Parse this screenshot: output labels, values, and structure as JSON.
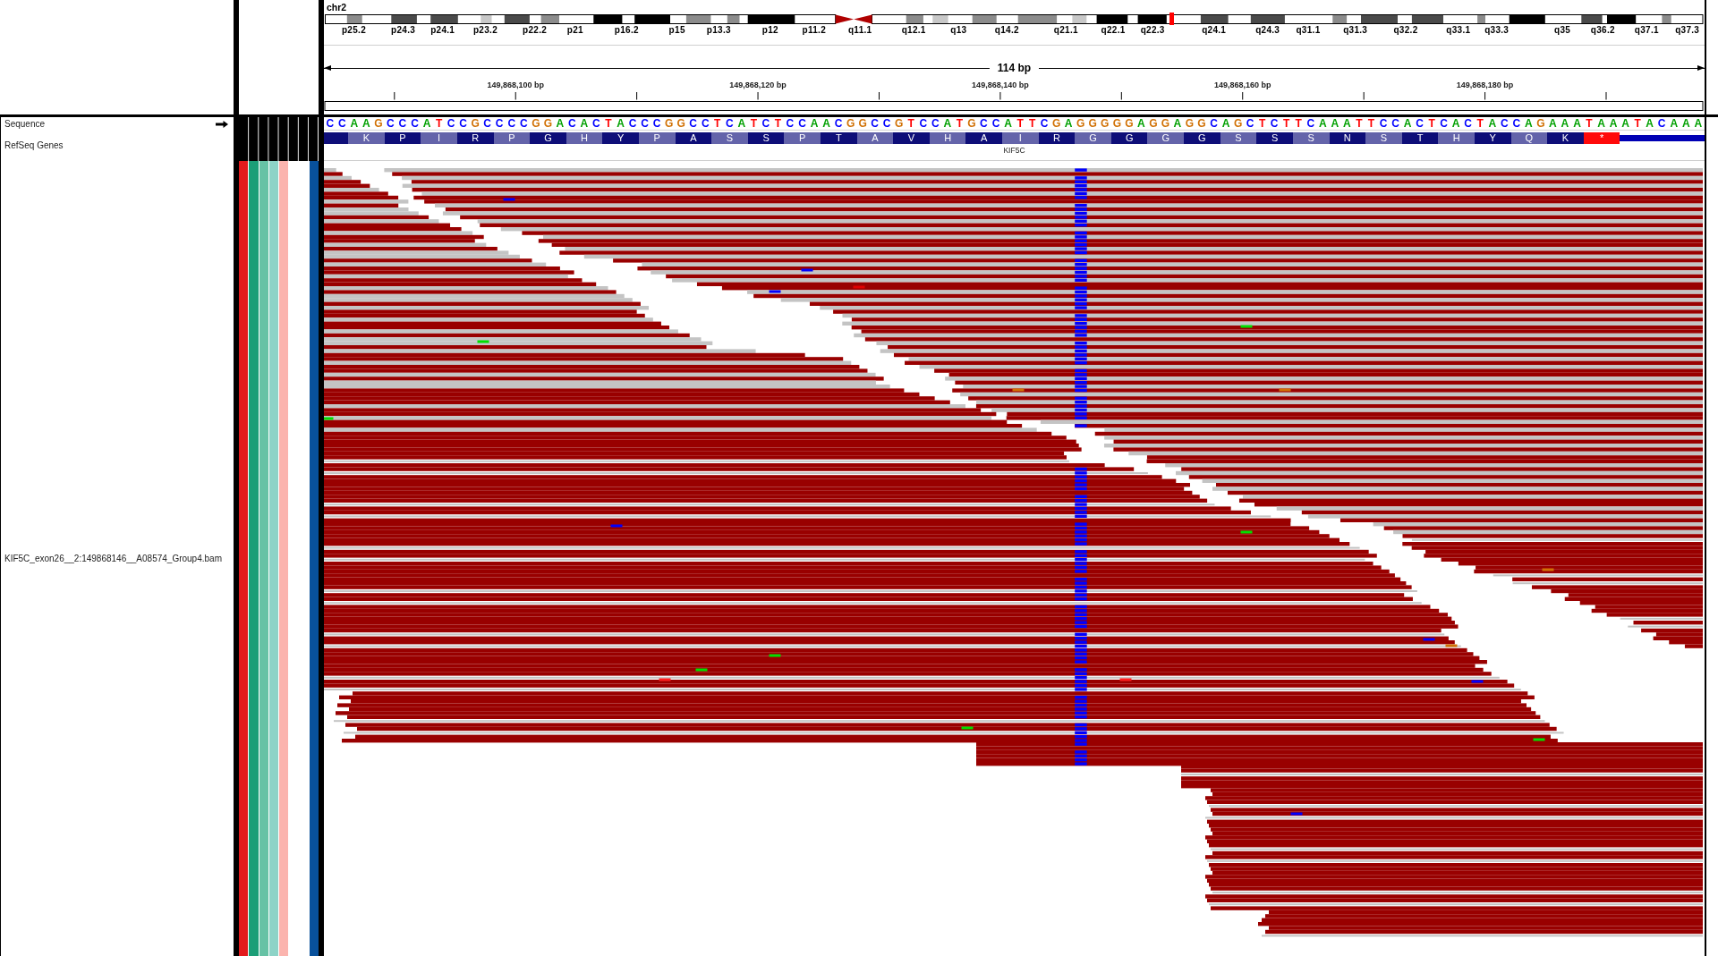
{
  "ideogram": {
    "chromosome": "chr2",
    "band_labels": [
      "p25.2",
      "p24.3",
      "p24.1",
      "p23.2",
      "p22.2",
      "p21",
      "p16.2",
      "p15",
      "p13.3",
      "p12",
      "p11.2",
      "q11.1",
      "q12.1",
      "q13",
      "q14.2",
      "q21.1",
      "q22.1",
      "q22.3",
      "q24.1",
      "q24.3",
      "q31.1",
      "q31.3",
      "q32.2",
      "q33.1",
      "q33.3",
      "q35",
      "q36.2",
      "q37.1",
      "q37.3"
    ]
  },
  "ruler": {
    "span": "114 bp",
    "tick_labels": [
      "149,868,100 bp",
      "149,868,120 bp",
      "149,868,140 bp",
      "149,868,160 bp",
      "149,868,180 bp"
    ]
  },
  "tracks": [
    {
      "kind": "sequence",
      "name": "Sequence",
      "forward": true,
      "bases": [
        {
          "base": "C",
          "color": "#0000ff"
        },
        {
          "base": "C",
          "color": "#0000ff"
        },
        {
          "base": "A",
          "color": "#00a000"
        },
        {
          "base": "A",
          "color": "#00a000"
        },
        {
          "base": "G",
          "color": "#d17105"
        },
        {
          "base": "C",
          "color": "#0000ff"
        },
        {
          "base": "C",
          "color": "#0000ff"
        },
        {
          "base": "C",
          "color": "#0000ff"
        },
        {
          "base": "A",
          "color": "#00a000"
        },
        {
          "base": "T",
          "color": "#ff0000"
        },
        {
          "base": "C",
          "color": "#0000ff"
        },
        {
          "base": "C",
          "color": "#0000ff"
        },
        {
          "base": "G",
          "color": "#d17105"
        },
        {
          "base": "C",
          "color": "#0000ff"
        },
        {
          "base": "C",
          "color": "#0000ff"
        },
        {
          "base": "C",
          "color": "#0000ff"
        },
        {
          "base": "C",
          "color": "#0000ff"
        },
        {
          "base": "G",
          "color": "#d17105"
        },
        {
          "base": "G",
          "color": "#d17105"
        },
        {
          "base": "A",
          "color": "#00a000"
        },
        {
          "base": "C",
          "color": "#0000ff"
        },
        {
          "base": "A",
          "color": "#00a000"
        },
        {
          "base": "C",
          "color": "#0000ff"
        },
        {
          "base": "T",
          "color": "#ff0000"
        },
        {
          "base": "A",
          "color": "#00a000"
        },
        {
          "base": "C",
          "color": "#0000ff"
        },
        {
          "base": "C",
          "color": "#0000ff"
        },
        {
          "base": "C",
          "color": "#0000ff"
        },
        {
          "base": "G",
          "color": "#d17105"
        },
        {
          "base": "G",
          "color": "#d17105"
        },
        {
          "base": "C",
          "color": "#0000ff"
        },
        {
          "base": "C",
          "color": "#0000ff"
        },
        {
          "base": "T",
          "color": "#ff0000"
        },
        {
          "base": "C",
          "color": "#0000ff"
        },
        {
          "base": "A",
          "color": "#00a000"
        },
        {
          "base": "T",
          "color": "#ff0000"
        },
        {
          "base": "C",
          "color": "#0000ff"
        },
        {
          "base": "T",
          "color": "#ff0000"
        },
        {
          "base": "C",
          "color": "#0000ff"
        },
        {
          "base": "C",
          "color": "#0000ff"
        },
        {
          "base": "A",
          "color": "#00a000"
        },
        {
          "base": "A",
          "color": "#00a000"
        },
        {
          "base": "C",
          "color": "#0000ff"
        },
        {
          "base": "G",
          "color": "#d17105"
        },
        {
          "base": "G",
          "color": "#d17105"
        },
        {
          "base": "C",
          "color": "#0000ff"
        },
        {
          "base": "C",
          "color": "#0000ff"
        },
        {
          "base": "G",
          "color": "#d17105"
        },
        {
          "base": "T",
          "color": "#ff0000"
        },
        {
          "base": "C",
          "color": "#0000ff"
        },
        {
          "base": "C",
          "color": "#0000ff"
        },
        {
          "base": "A",
          "color": "#00a000"
        },
        {
          "base": "T",
          "color": "#ff0000"
        },
        {
          "base": "G",
          "color": "#d17105"
        },
        {
          "base": "C",
          "color": "#0000ff"
        },
        {
          "base": "C",
          "color": "#0000ff"
        },
        {
          "base": "A",
          "color": "#00a000"
        },
        {
          "base": "T",
          "color": "#ff0000"
        },
        {
          "base": "T",
          "color": "#ff0000"
        },
        {
          "base": "C",
          "color": "#0000ff"
        },
        {
          "base": "G",
          "color": "#d17105"
        },
        {
          "base": "A",
          "color": "#00a000"
        },
        {
          "base": "G",
          "color": "#d17105"
        },
        {
          "base": "G",
          "color": "#d17105"
        },
        {
          "base": "G",
          "color": "#d17105"
        },
        {
          "base": "G",
          "color": "#d17105"
        },
        {
          "base": "G",
          "color": "#d17105"
        },
        {
          "base": "A",
          "color": "#00a000"
        },
        {
          "base": "G",
          "color": "#d17105"
        },
        {
          "base": "G",
          "color": "#d17105"
        },
        {
          "base": "A",
          "color": "#00a000"
        },
        {
          "base": "G",
          "color": "#d17105"
        },
        {
          "base": "G",
          "color": "#d17105"
        },
        {
          "base": "C",
          "color": "#0000ff"
        },
        {
          "base": "A",
          "color": "#00a000"
        },
        {
          "base": "G",
          "color": "#d17105"
        },
        {
          "base": "C",
          "color": "#0000ff"
        },
        {
          "base": "T",
          "color": "#ff0000"
        },
        {
          "base": "C",
          "color": "#0000ff"
        },
        {
          "base": "T",
          "color": "#ff0000"
        },
        {
          "base": "T",
          "color": "#ff0000"
        },
        {
          "base": "C",
          "color": "#0000ff"
        },
        {
          "base": "A",
          "color": "#00a000"
        },
        {
          "base": "A",
          "color": "#00a000"
        },
        {
          "base": "A",
          "color": "#00a000"
        },
        {
          "base": "T",
          "color": "#ff0000"
        },
        {
          "base": "T",
          "color": "#ff0000"
        },
        {
          "base": "C",
          "color": "#0000ff"
        },
        {
          "base": "C",
          "color": "#0000ff"
        },
        {
          "base": "A",
          "color": "#00a000"
        },
        {
          "base": "C",
          "color": "#0000ff"
        },
        {
          "base": "T",
          "color": "#ff0000"
        },
        {
          "base": "C",
          "color": "#0000ff"
        },
        {
          "base": "A",
          "color": "#00a000"
        },
        {
          "base": "C",
          "color": "#0000ff"
        },
        {
          "base": "T",
          "color": "#ff0000"
        },
        {
          "base": "A",
          "color": "#00a000"
        },
        {
          "base": "C",
          "color": "#0000ff"
        },
        {
          "base": "C",
          "color": "#0000ff"
        },
        {
          "base": "A",
          "color": "#00a000"
        },
        {
          "base": "G",
          "color": "#d17105"
        },
        {
          "base": "A",
          "color": "#00a000"
        },
        {
          "base": "A",
          "color": "#00a000"
        },
        {
          "base": "A",
          "color": "#00a000"
        },
        {
          "base": "T",
          "color": "#ff0000"
        },
        {
          "base": "A",
          "color": "#00a000"
        },
        {
          "base": "A",
          "color": "#00a000"
        },
        {
          "base": "A",
          "color": "#00a000"
        },
        {
          "base": "T",
          "color": "#ff0000"
        },
        {
          "base": "A",
          "color": "#00a000"
        },
        {
          "base": "C",
          "color": "#0000ff"
        },
        {
          "base": "A",
          "color": "#00a000"
        },
        {
          "base": "A",
          "color": "#00a000"
        },
        {
          "base": "A",
          "color": "#00a000"
        }
      ]
    },
    {
      "kind": "gene",
      "name": "RefSeq Genes",
      "gene": "KIF5C",
      "features": [
        {
          "kind": "partial"
        },
        {
          "kind": "codon",
          "residue": "K"
        },
        {
          "kind": "codon",
          "residue": "P"
        },
        {
          "kind": "codon",
          "residue": "I"
        },
        {
          "kind": "codon",
          "residue": "R"
        },
        {
          "kind": "codon",
          "residue": "P"
        },
        {
          "kind": "codon",
          "residue": "G"
        },
        {
          "kind": "codon",
          "residue": "H"
        },
        {
          "kind": "codon",
          "residue": "Y"
        },
        {
          "kind": "codon",
          "residue": "P"
        },
        {
          "kind": "codon",
          "residue": "A"
        },
        {
          "kind": "codon",
          "residue": "S"
        },
        {
          "kind": "codon",
          "residue": "S"
        },
        {
          "kind": "codon",
          "residue": "P"
        },
        {
          "kind": "codon",
          "residue": "T"
        },
        {
          "kind": "codon",
          "residue": "A"
        },
        {
          "kind": "codon",
          "residue": "V"
        },
        {
          "kind": "codon",
          "residue": "H"
        },
        {
          "kind": "codon",
          "residue": "A"
        },
        {
          "kind": "codon",
          "residue": "I"
        },
        {
          "kind": "codon",
          "residue": "R"
        },
        {
          "kind": "codon",
          "residue": "G"
        },
        {
          "kind": "codon",
          "residue": "G"
        },
        {
          "kind": "codon",
          "residue": "G"
        },
        {
          "kind": "codon",
          "residue": "G"
        },
        {
          "kind": "codon",
          "residue": "S"
        },
        {
          "kind": "codon",
          "residue": "S"
        },
        {
          "kind": "codon",
          "residue": "S"
        },
        {
          "kind": "codon",
          "residue": "N"
        },
        {
          "kind": "codon",
          "residue": "S"
        },
        {
          "kind": "codon",
          "residue": "T"
        },
        {
          "kind": "codon",
          "residue": "H"
        },
        {
          "kind": "codon",
          "residue": "Y"
        },
        {
          "kind": "codon",
          "residue": "Q"
        },
        {
          "kind": "codon",
          "residue": "K"
        },
        {
          "kind": "stop",
          "residue": "*"
        },
        {
          "kind": "utr"
        }
      ]
    },
    {
      "kind": "alignment",
      "name": "KIF5C_exon26__2:149868146__A08574_Group4.bam",
      "attributes": [
        {
          "blank": false,
          "color": "#e31a1c"
        },
        {
          "blank": false,
          "color": "#1b9e77"
        },
        {
          "blank": false,
          "color": "#66c2a5"
        },
        {
          "blank": false,
          "color": "#8dd3c7"
        },
        {
          "blank": false,
          "color": "#fbb4ae"
        },
        {
          "blank": true
        },
        {
          "blank": true
        },
        {
          "blank": false,
          "color": "#08519c"
        }
      ]
    }
  ]
}
